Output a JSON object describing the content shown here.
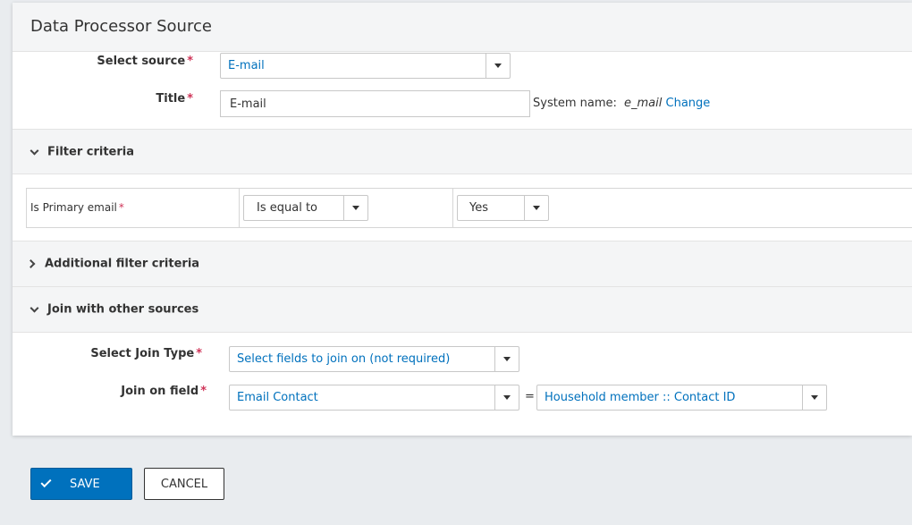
{
  "panel": {
    "title": "Data Processor Source"
  },
  "form": {
    "select_source": {
      "label": "Select source",
      "value": "E-mail"
    },
    "title": {
      "label": "Title",
      "value": "E-mail",
      "system_name_label": "System name:",
      "system_name_value": "e_mail",
      "change_link": "Change"
    }
  },
  "filter_section": {
    "label": "Filter criteria",
    "row": {
      "field": "Is Primary email",
      "operator": "Is equal to",
      "value": "Yes"
    }
  },
  "additional_filter_section": {
    "label": "Additional filter criteria"
  },
  "join_section": {
    "label": "Join with other sources",
    "join_type": {
      "label": "Select Join Type",
      "value": "Select fields to join on (not required)"
    },
    "join_field": {
      "label": "Join on field",
      "left_value": "Email Contact",
      "equals": "=",
      "right_value": "Household member :: Contact ID"
    }
  },
  "required_marker": "*",
  "buttons": {
    "save": "SAVE",
    "cancel": "CANCEL"
  },
  "colors": {
    "accent": "#0071bd",
    "required": "#cf3458",
    "background": "#e9ecef"
  },
  "icons": [
    "chevron-down-icon",
    "chevron-right-icon",
    "dropdown-arrow-icon",
    "check-icon"
  ]
}
